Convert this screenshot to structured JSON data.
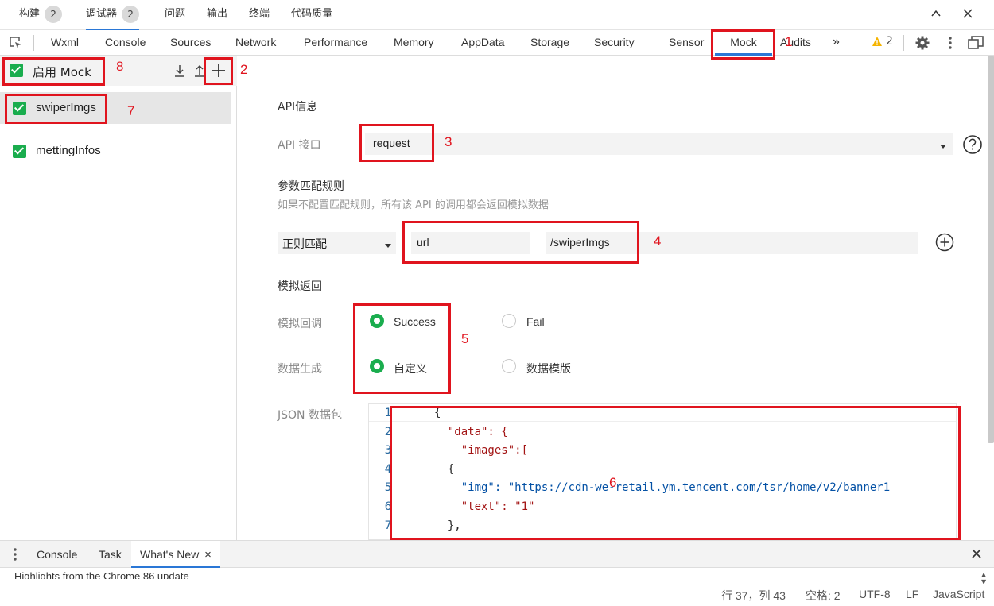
{
  "top_tabs": [
    {
      "label": "构建",
      "badge": "2"
    },
    {
      "label": "调试器",
      "badge": "2"
    },
    {
      "label": "问题"
    },
    {
      "label": "输出"
    },
    {
      "label": "终端"
    },
    {
      "label": "代码质量"
    }
  ],
  "window_buttons": {
    "collapse": "chevron-up-icon",
    "close": "close-icon"
  },
  "devtools_tabs": [
    "Wxml",
    "Console",
    "Sources",
    "Network",
    "Performance",
    "Memory",
    "AppData",
    "Storage",
    "Security",
    "Sensor",
    "Mock",
    "Audits"
  ],
  "devtools_right": {
    "more": "»",
    "warning_count": "2"
  },
  "annotations": {
    "n1": "1",
    "n2": "2",
    "n3": "3",
    "n4": "4",
    "n5": "5",
    "n6": "6",
    "n7": "7",
    "n8": "8"
  },
  "sidebar": {
    "enable_label": "启用 Mock",
    "items": [
      {
        "label": "swiperImgs",
        "checked": true,
        "selected": true
      },
      {
        "label": "mettingInfos",
        "checked": true,
        "selected": false
      }
    ]
  },
  "main": {
    "api_info_title": "API信息",
    "api_interface_label": "API 接口",
    "api_interface_value": "request",
    "match_rules_title": "参数匹配规则",
    "match_rules_hint": "如果不配置匹配规则，所有该 API 的调用都会返回模拟数据",
    "match_type": "正则匹配",
    "match_key": "url",
    "match_value": "/swiperImgs",
    "mock_return_title": "模拟返回",
    "mock_callback_label": "模拟回调",
    "callback_success": "Success",
    "callback_fail": "Fail",
    "data_gen_label": "数据生成",
    "data_gen_custom": "自定义",
    "data_gen_template": "数据模版",
    "json_label": "JSON 数据包"
  },
  "editor": {
    "line_numbers": [
      "1",
      "2",
      "3",
      "4",
      "5",
      "6",
      "7"
    ],
    "lines": [
      "{",
      "  \"data\": {",
      "    \"images\":[",
      "  {",
      "    \"img\": \"https://cdn-we-retail.ym.tencent.com/tsr/home/v2/banner1",
      "    \"text\": \"1\"",
      "  },"
    ]
  },
  "drawer": {
    "tabs": [
      "Console",
      "Task",
      "What's New"
    ],
    "highlights_text": "Highlights from the Chrome 86 update"
  },
  "status_bar": {
    "position": "行 37，列 43",
    "spaces": "空格: 2",
    "encoding": "UTF-8",
    "eol": "LF",
    "language": "JavaScript"
  },
  "colors": {
    "accent": "#2a77d6",
    "green": "#1aad4e",
    "annotation_red": "#e0141e"
  }
}
